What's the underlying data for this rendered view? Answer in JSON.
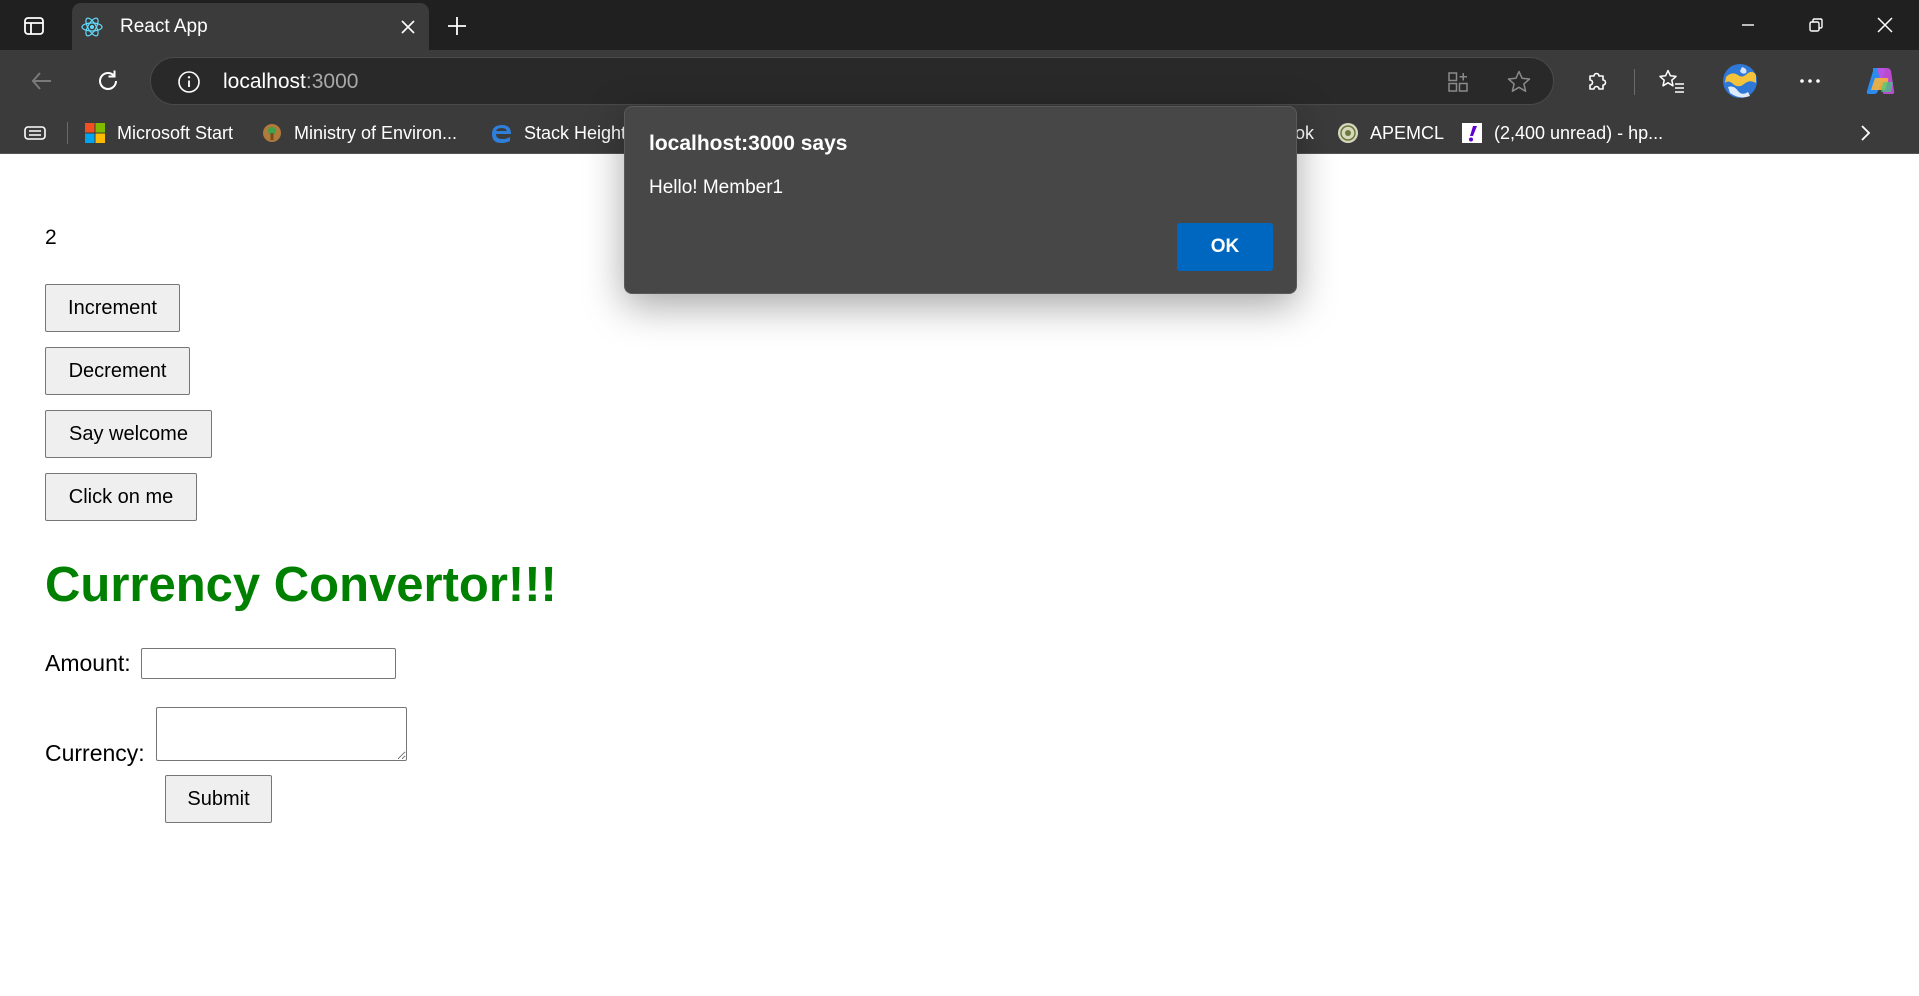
{
  "browser": {
    "tab": {
      "title": "React App"
    },
    "address_bar": {
      "host": "localhost",
      "port": ":3000"
    },
    "favorites": [
      {
        "label": "Microsoft Start",
        "icon": "microsoft-logo-icon"
      },
      {
        "label": "Ministry of Environ...",
        "icon": "ministry-emblem-icon"
      },
      {
        "label": "Stack Height",
        "icon": "edge-e-icon"
      },
      {
        "label": "ok",
        "icon": ""
      },
      {
        "label": "APEMCL",
        "icon": "apemcl-seal-icon"
      },
      {
        "label": "(2,400 unread) - hp...",
        "icon": "yahoo-mail-icon"
      }
    ]
  },
  "page": {
    "counter_value": "2",
    "buttons": {
      "increment": "Increment",
      "decrement": "Decrement",
      "say_welcome": "Say welcome",
      "click_on_me": "Click on me"
    },
    "heading": "Currency Convertor!!!",
    "amount_label": "Amount:",
    "amount_value": "",
    "currency_label": "Currency:",
    "currency_value": "",
    "submit_label": "Submit"
  },
  "dialog": {
    "title": "localhost:3000 says",
    "message": "Hello! Member1",
    "ok_label": "OK"
  },
  "colors": {
    "heading": "#008000",
    "dialog_ok": "#0067c0",
    "chrome_dark": "#202020",
    "chrome_toolbar": "#3b3b3b"
  }
}
